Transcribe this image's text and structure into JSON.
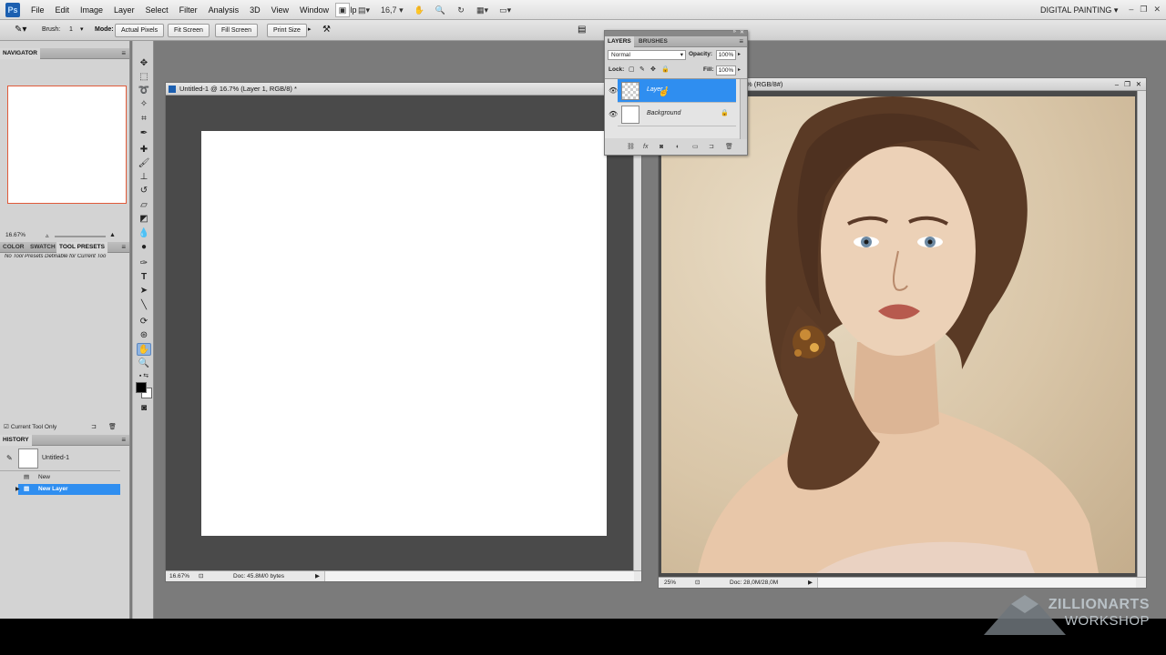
{
  "app": {
    "logo": "Ps",
    "menus": [
      "File",
      "Edit",
      "Image",
      "Layer",
      "Select",
      "Filter",
      "Analysis",
      "3D",
      "View",
      "Window",
      "Help"
    ],
    "zoom_box": "16,7",
    "workspace": "DIGITAL PAINTING"
  },
  "options_bar": {
    "brush_label": "Brush:",
    "brush_size": "1",
    "mode_label": "Mode:",
    "actual_pixels": "Actual Pixels",
    "fit_screen": "Fit Screen",
    "fill_screen": "Fill Screen",
    "print_size": "Print Size"
  },
  "navigator": {
    "title": "NAVIGATOR",
    "zoom": "16.67%"
  },
  "presets_panel": {
    "tabs": [
      "COLOR",
      "SWATCH",
      "TOOL PRESETS"
    ],
    "empty_message": "No Tool Presets Definable for Current Too",
    "current_tool_only": "Current Tool Only"
  },
  "history": {
    "title": "HISTORY",
    "snapshot": "Untitled-1",
    "states": [
      "New",
      "New Layer"
    ]
  },
  "document1": {
    "title": "Untitled-1 @ 16.7% (Layer 1, RGB/8) *",
    "zoom": "16.67%",
    "doc_size": "Doc: 45.8M/0 bytes"
  },
  "document2": {
    "title": "% (RGB/8#)",
    "zoom": "25%",
    "doc_size": "Doc: 28,0M/28,0M"
  },
  "layers_panel": {
    "tabs": [
      "LAYERS",
      "BRUSHES"
    ],
    "blend_mode": "Normal",
    "opacity_label": "Opacity:",
    "opacity": "100%",
    "lock_label": "Lock:",
    "fill_label": "Fill:",
    "fill": "100%",
    "layers": [
      {
        "name": "Layer 1",
        "selected": true
      },
      {
        "name": "Background",
        "selected": false
      }
    ]
  },
  "watermark": {
    "line1": "ZILLIONARTS",
    "line2": "WORKSHOP"
  },
  "colors": {
    "accent": "#2f8ef0",
    "workspace_bg": "#7b7b7b",
    "doc_bg": "#4a4a4a"
  }
}
